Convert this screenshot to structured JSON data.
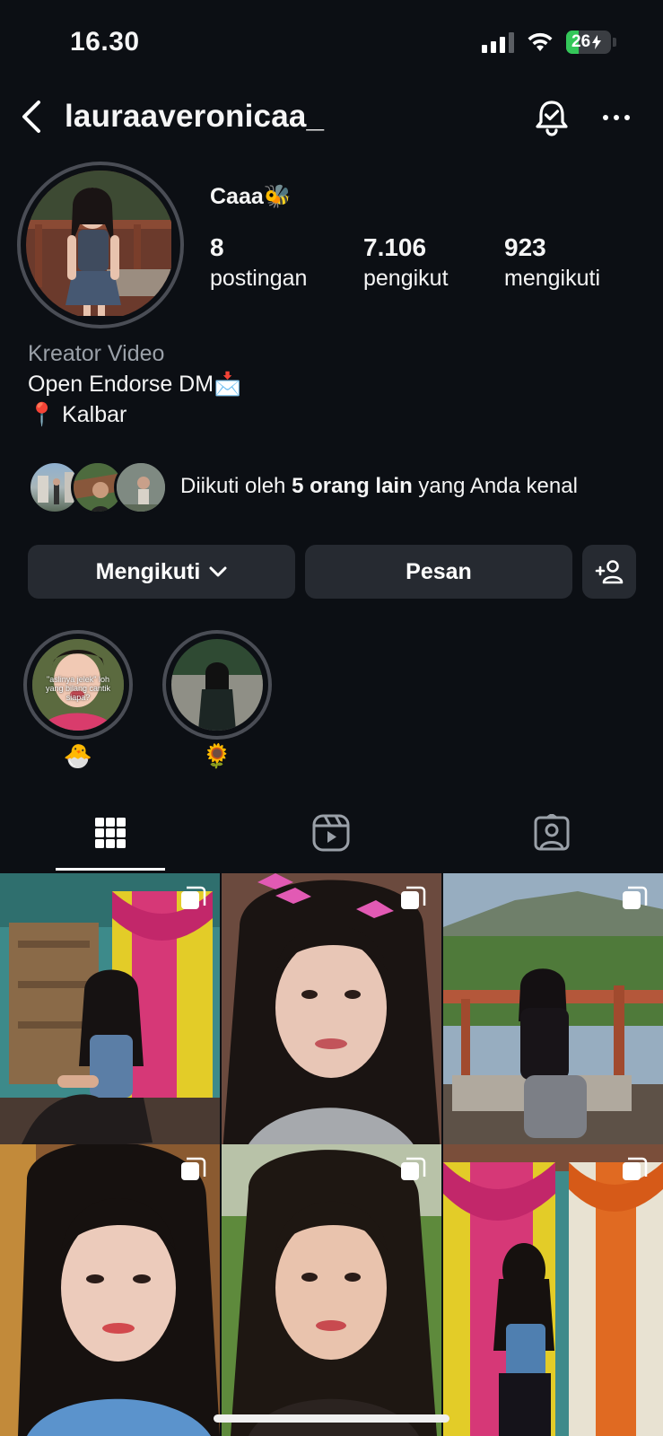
{
  "status_bar": {
    "time": "16.30",
    "battery": "26"
  },
  "header": {
    "username": "lauraaveronicaa_"
  },
  "profile": {
    "display_name": "Caaa🐝",
    "stats": [
      {
        "value": "8",
        "label": "postingan"
      },
      {
        "value": "7.106",
        "label": "pengikut"
      },
      {
        "value": "923",
        "label": "mengikuti"
      }
    ],
    "category": "Kreator Video",
    "bio": [
      "Open Endorse DM📩",
      "📍 Kalbar"
    ],
    "mutual": {
      "prefix": "Diikuti oleh ",
      "bold": "5 orang lain",
      "suffix": " yang Anda kenal"
    }
  },
  "buttons": {
    "following": "Mengikuti",
    "message": "Pesan"
  },
  "highlights": [
    {
      "label": "🐣",
      "caption": "\"aslinya jelek\" loh yang bilang cantik siapa?"
    },
    {
      "label": "🌻"
    }
  ],
  "tabs": [
    {
      "icon": "grid-icon",
      "active": true
    },
    {
      "icon": "reels-icon",
      "active": false
    },
    {
      "icon": "tagged-icon",
      "active": false
    }
  ],
  "posts_count_visible": 6,
  "colors": {
    "background": "#0c0f14",
    "button": "#262a31",
    "battery_green": "#34c759"
  }
}
